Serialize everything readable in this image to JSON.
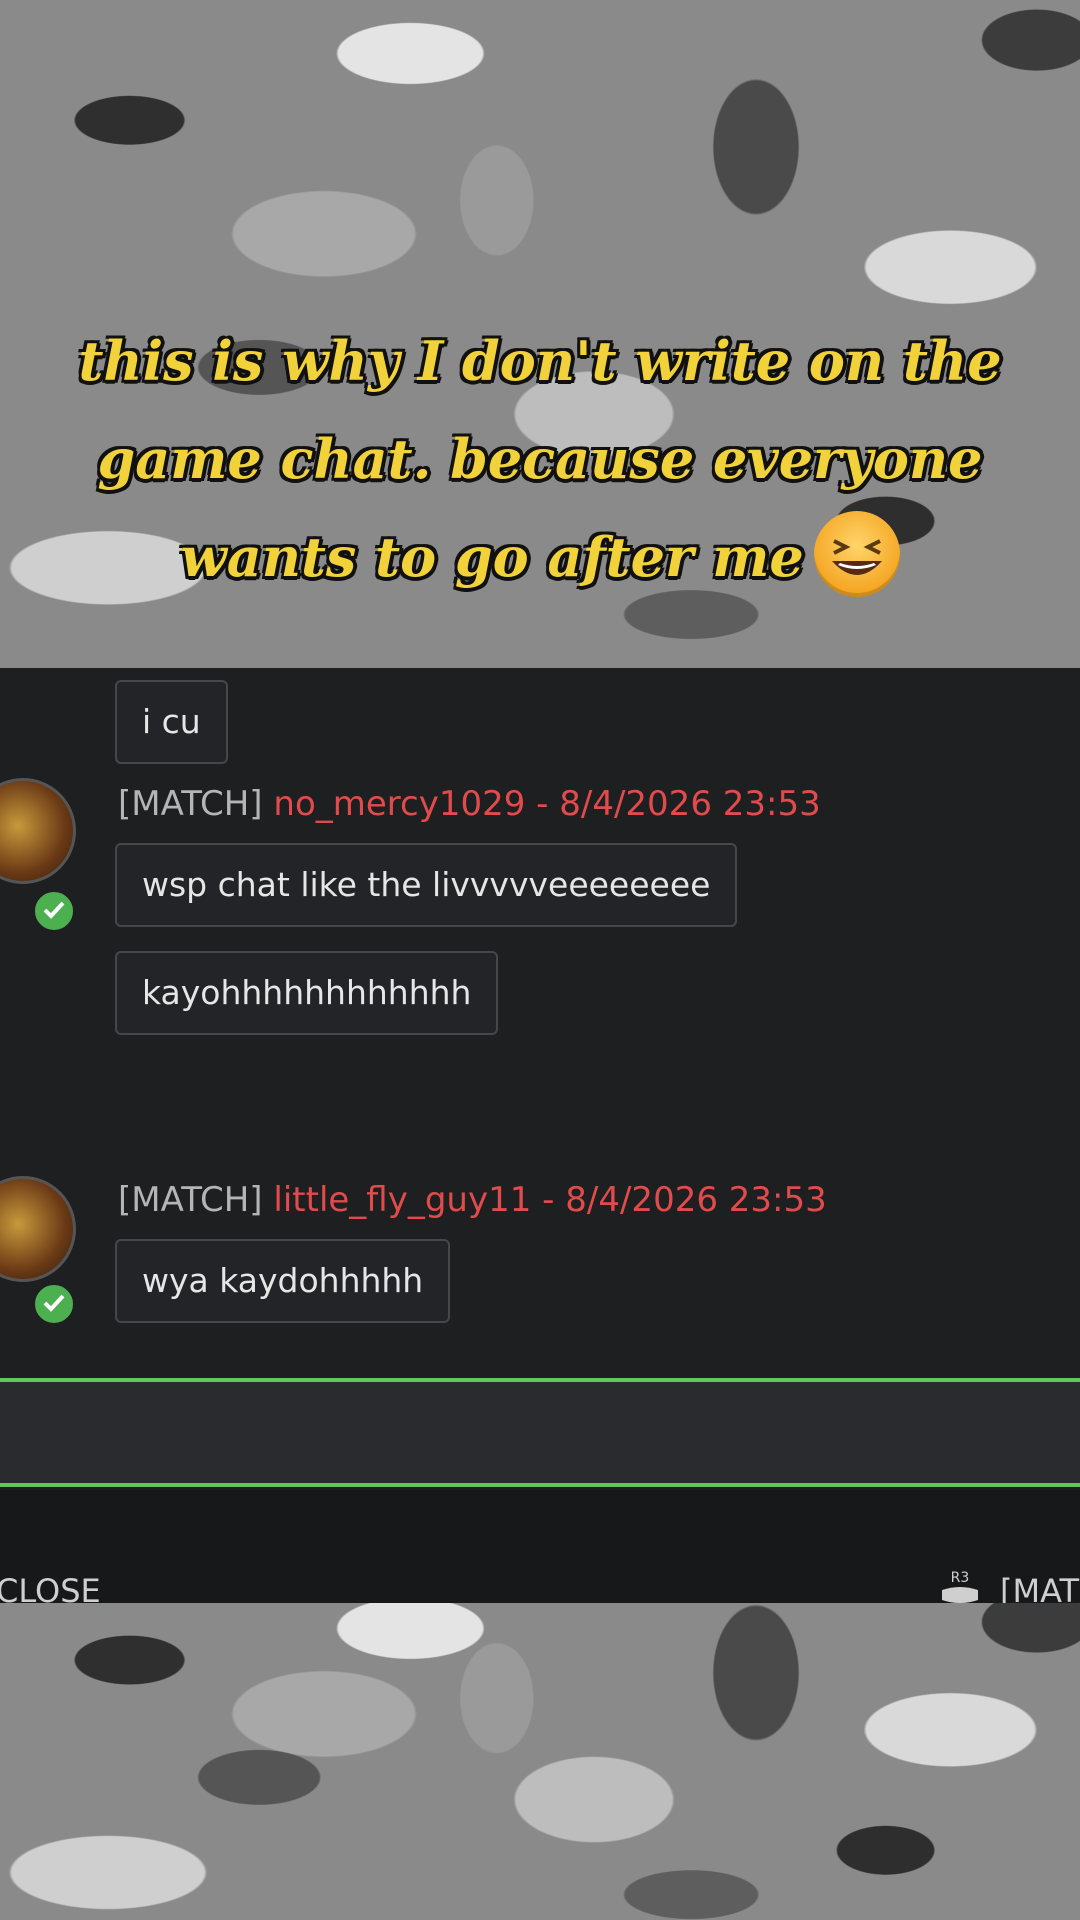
{
  "caption": {
    "text": "this is why I don't write on the game chat. because everyone wants to go after me",
    "emoji": "laughing-squinting-face"
  },
  "chat": {
    "messages": [
      {
        "text": "i cu"
      },
      {
        "channel": "[MATCH]",
        "user": "no_mercy1029",
        "timestamp": " - 8/4/2026 23:53",
        "lines": [
          "wsp chat like the livvvvveeeeeeee",
          "kayohhhhhhhhhhhh"
        ]
      },
      {
        "channel": "[MATCH]",
        "user": "little_fly_guy11",
        "timestamp": " - 8/4/2026 23:53",
        "lines": [
          "wya kaydohhhhh"
        ]
      }
    ]
  },
  "footer": {
    "close_label": "CLOSE",
    "r3_icon": "R3",
    "channel_label": "[MAT"
  },
  "colors": {
    "username": "#e24b4b",
    "input_border": "#5ec85e",
    "caption": "#f2d23a"
  }
}
